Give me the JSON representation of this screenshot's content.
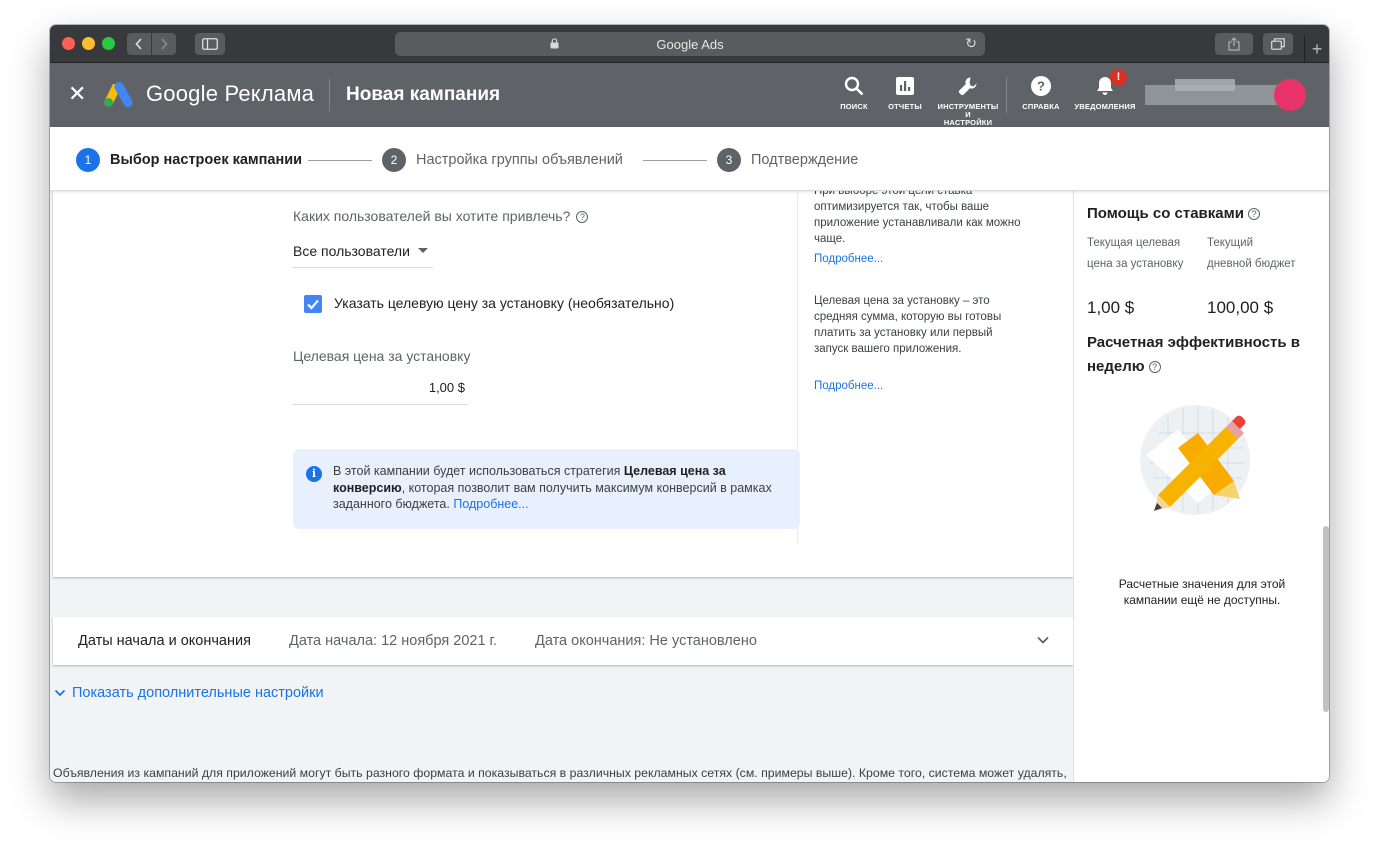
{
  "browser": {
    "url_title": "Google Ads"
  },
  "header": {
    "brand": "Google Реклама",
    "page_title": "Новая кампания",
    "tools": {
      "search": "ПОИСК",
      "reports": "ОТЧЕТЫ",
      "tools_line1": "ИНСТРУМЕНТЫ",
      "tools_line2": "И",
      "tools_line3": "НАСТРОЙКИ",
      "help": "СПРАВКА",
      "notifications": "УВЕДОМЛЕНИЯ"
    },
    "notification_badge": "!"
  },
  "stepper": {
    "steps": [
      {
        "num": "1",
        "label": "Выбор настроек кампании"
      },
      {
        "num": "2",
        "label": "Настройка группы объявлений"
      },
      {
        "num": "3",
        "label": "Подтверждение"
      }
    ]
  },
  "form": {
    "users_question": "Каких пользователей вы хотите привлечь?",
    "users_select": "Все пользователи",
    "target_checkbox_label": "Указать целевую цену за установку (необязательно)",
    "target_price_label": "Целевая цена за установку",
    "target_price_value": "1,00 $",
    "info_part1": "В этой кампании будет использоваться стратегия ",
    "info_bold": "Целевая цена за конверсию",
    "info_part2": ", которая позволит вам получить максимум конверсий в рамках заданного бюджета. ",
    "info_link": "Подробнее..."
  },
  "sidebar_help": {
    "text1": "При выборе этой цели ставка оптимизируется так, чтобы ваше приложение устанавливали как можно чаще.",
    "link1": "Подробнее...",
    "text2": "Целевая цена за установку – это средняя сумма, которую вы готовы платить за установку или первый запуск вашего приложения.",
    "link2": "Подробнее..."
  },
  "dates": {
    "title": "Даты начала и окончания",
    "start": "Дата начала: 12 ноября 2021 г.",
    "end": "Дата окончания: Не установлено"
  },
  "more_settings": "Показать дополнительные настройки",
  "disclaimer": "Объявления из кампаний для приложений могут быть разного формата и показываться в различных рекламных сетях (см. примеры выше). Кроме того, система может удалять, кадрировать и изменять контент, предоставленный вами либо автоматически полученный со страницы приложения в Google Play или App Store либо с вашего сайта (только со страниц с универсальными ссылками и ссылками на ваше приложение). Рекламируя приложение в Google, вы даете согласие на показ",
  "right_panel": {
    "bid_help_title": "Помощь со ставками",
    "current_target_label": "Текущая целевая цена за установку",
    "current_budget_label": "Текущий дневной бюджет",
    "current_target_value": "1,00 $",
    "current_budget_value": "100,00 $",
    "perf_title": "Расчетная эффективность в неделю",
    "perf_note": "Расчетные значения для этой кампании ещё не доступны."
  },
  "colors": {
    "accent": "#1a73e8",
    "header_bg": "#5f6368",
    "info_bg": "#e8f0fe",
    "checkbox": "#4285f4"
  }
}
